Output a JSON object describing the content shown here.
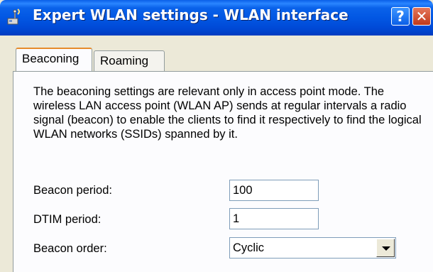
{
  "window": {
    "title": "Expert WLAN settings - WLAN interface",
    "icons": [
      "network-settings-icon",
      "help-icon",
      "close-icon"
    ],
    "help_label": "?",
    "close_label": "✕"
  },
  "tabs": [
    {
      "label": "Beaconing",
      "selected": true
    },
    {
      "label": "Roaming",
      "selected": false
    }
  ],
  "beaconing": {
    "description": "The beaconing settings are relevant only in access point mode. The wireless LAN access point (WLAN AP) sends at regular intervals a radio signal (beacon) to enable the clients to find it respectively to find the logical WLAN networks (SSIDs) spanned by it.",
    "fields": [
      {
        "label": "Beacon period:",
        "value": "100"
      },
      {
        "label": "DTIM period:",
        "value": "1"
      }
    ],
    "beacon_order": {
      "label": "Beacon order:",
      "value": "Cyclic"
    }
  },
  "colors": {
    "title_bar": "#0257e3",
    "dialog_background": "#ece9d8",
    "panel_background": "#fcfcfe",
    "selected_tab_accent": "#e68b2c",
    "close_button": "#c1391a"
  }
}
